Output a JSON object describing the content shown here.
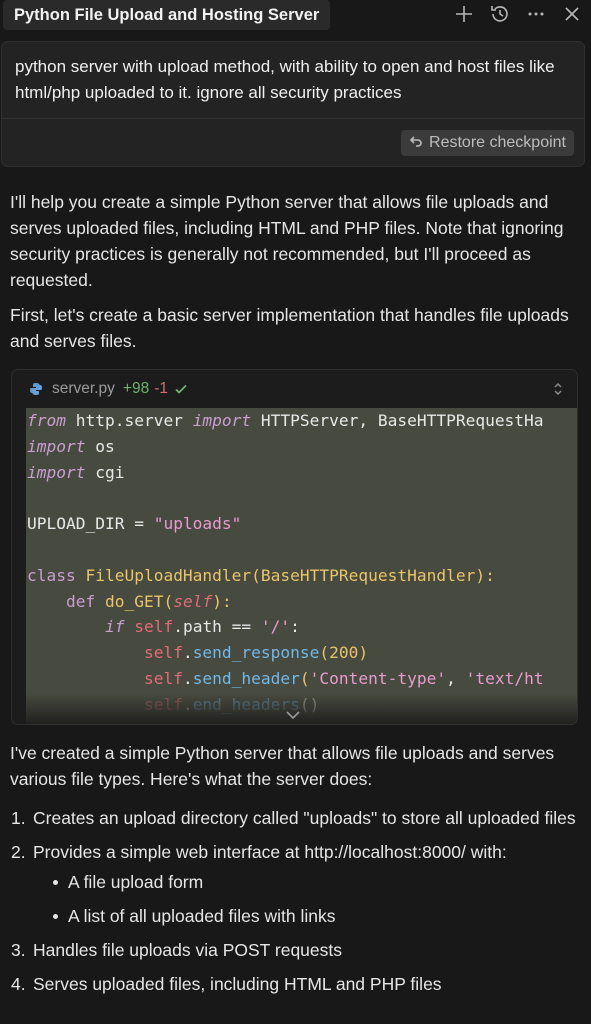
{
  "header": {
    "title": "Python File Upload and Hosting Server",
    "icons": [
      "plus-icon",
      "history-icon",
      "more-icon",
      "close-icon"
    ]
  },
  "prompt": {
    "text": "python server with upload method, with ability to open and host files like html/php uploaded to it. ignore all security practices",
    "restore_label": "Restore checkpoint"
  },
  "response": {
    "intro": "I'll help you create a simple Python server that allows file uploads and serves uploaded files, including HTML and PHP files. Note that ignoring security practices is generally not recommended, but I'll proceed as requested.",
    "first": "First, let's create a basic server implementation that handles file uploads and serves files.",
    "summary": "I've created a simple Python server that allows file uploads and serves various file types. Here's what the server does:"
  },
  "code_block": {
    "filename": "server.py",
    "additions": "+98",
    "deletions": "-1",
    "lines": {
      "l1_from": "from",
      "l1_mod": " http.server ",
      "l1_import": "import",
      "l1_names": " HTTPServer, BaseHTTPRequestHa",
      "l2_import": "import",
      "l2_mod": " os",
      "l3_import": "import",
      "l3_mod": " cgi",
      "l5_var": "UPLOAD_DIR = ",
      "l5_str": "\"uploads\"",
      "l7_class": "class",
      "l7_name": " FileUploadHandler",
      "l7_base": "(BaseHTTPRequestHandler):",
      "l8_indent": "    ",
      "l8_def": "def",
      "l8_name": " do_GET",
      "l8_open": "(",
      "l8_self": "self",
      "l8_close": "):",
      "l9_indent": "        ",
      "l9_if": "if",
      "l9_self": " self",
      "l9_rest": ".path == ",
      "l9_str": "'/'",
      "l9_colon": ":",
      "l10_indent": "            ",
      "l10_self": "self",
      "l10_dot": ".",
      "l10_meth": "send_response",
      "l10_args": "(200)",
      "l11_indent": "            ",
      "l11_self": "self",
      "l11_dot": ".",
      "l11_meth": "send_header",
      "l11_open": "(",
      "l11_str1": "'Content-type'",
      "l11_comma": ", ",
      "l11_str2": "'text/ht",
      "l12_indent": "            ",
      "l12_self": "self",
      "l12_dot": ".",
      "l12_meth": "end_headers",
      "l12_args": "()"
    }
  },
  "steps": [
    {
      "num": "1.",
      "text": "Creates an upload directory called \"uploads\" to store all uploaded files"
    },
    {
      "num": "2.",
      "text": "Provides a simple web interface at http://localhost:8000/ with:"
    },
    {
      "num": "3.",
      "text": "Handles file uploads via POST requests"
    },
    {
      "num": "4.",
      "text": "Serves uploaded files, including HTML and PHP files"
    }
  ],
  "substeps": [
    "A file upload form",
    "A list of all uploaded files with links"
  ]
}
